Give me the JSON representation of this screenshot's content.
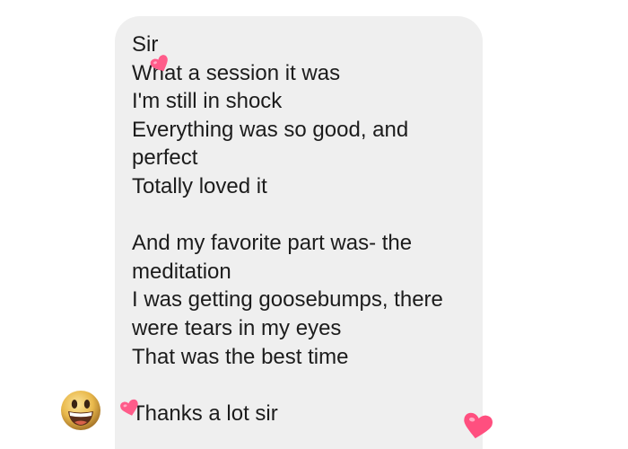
{
  "message": {
    "paragraphs": [
      [
        "Sir",
        "What a session it was",
        "I'm still in shock",
        "Everything was so good, and",
        "perfect",
        "Totally loved it"
      ],
      [
        "And my favorite part was- the",
        "meditation",
        "I was getting goosebumps, there",
        "were tears in my eyes",
        "That was the best time"
      ],
      [
        "Thanks a lot sir"
      ]
    ]
  },
  "sender": {
    "avatar_icon": "grinning-face-emoji-icon"
  },
  "decorations": {
    "heart_icon": "heart-icon",
    "heart_color": "#ff5c8a"
  }
}
